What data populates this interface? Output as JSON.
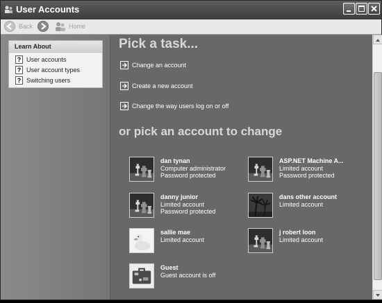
{
  "window": {
    "title": "User Accounts"
  },
  "toolbar": {
    "back_label": "Back",
    "home_label": "Home"
  },
  "sidebar": {
    "learn_title": "Learn About",
    "items": [
      {
        "label": "User accounts"
      },
      {
        "label": "User account types"
      },
      {
        "label": "Switching users"
      }
    ]
  },
  "main": {
    "task_heading": "Pick a task...",
    "tasks": [
      {
        "label": "Change an account"
      },
      {
        "label": "Create a new account"
      },
      {
        "label": "Change the way users log on or off"
      }
    ],
    "account_heading": "or pick an account to change",
    "accounts": [
      {
        "name": "dan tynan",
        "line2": "Computer administrator",
        "line3": "Password protected",
        "picture": "chess-pieces"
      },
      {
        "name": "ASP.NET Machine A...",
        "line2": "Limited account",
        "line3": "Password protected",
        "picture": "chess-pieces"
      },
      {
        "name": "danny junior",
        "line2": "Limited account",
        "line3": "Password protected",
        "picture": "chess-pieces"
      },
      {
        "name": "dans other account",
        "line2": "Limited account",
        "line3": "",
        "picture": "palm-trees"
      },
      {
        "name": "sallie mae",
        "line2": "Limited account",
        "line3": "",
        "picture": "rubber-duck"
      },
      {
        "name": "j robert loon",
        "line2": "Limited account",
        "line3": "",
        "picture": "chess-pieces"
      },
      {
        "name": "Guest",
        "line2": "Guest account is off",
        "line3": "",
        "picture": "suitcase"
      }
    ]
  }
}
